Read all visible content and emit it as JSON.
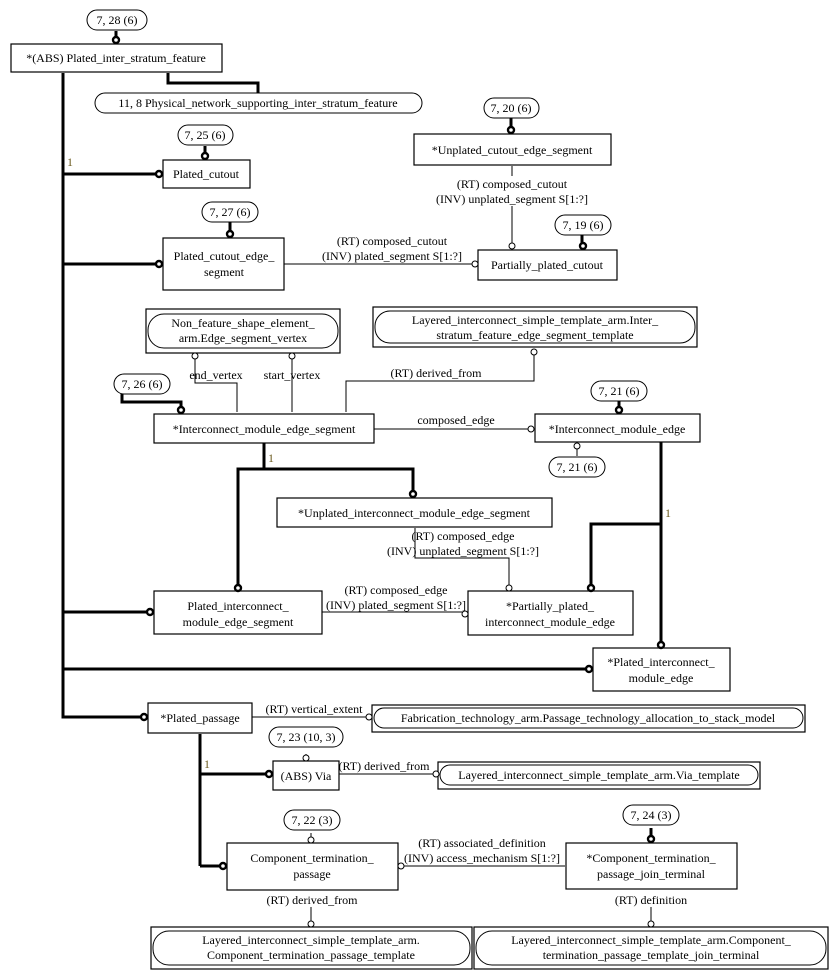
{
  "diagram": {
    "type": "EXPRESS-G schema diagram",
    "entities": {
      "plated_inter_stratum_feature": "*(ABS) Plated_inter_stratum_feature",
      "plated_cutout": "Plated_cutout",
      "unplated_cutout_edge_segment": "*Unplated_cutout_edge_segment",
      "plated_cutout_edge_segment": [
        "Plated_cutout_edge_",
        "segment"
      ],
      "partially_plated_cutout": "Partially_plated_cutout",
      "interconnect_module_edge_segment": "*Interconnect_module_edge_segment",
      "interconnect_module_edge": "*Interconnect_module_edge",
      "unplated_interconnect_module_edge_segment": "*Unplated_interconnect_module_edge_segment",
      "plated_interconnect_module_edge_segment": [
        "Plated_interconnect_",
        "module_edge_segment"
      ],
      "partially_plated_interconnect_module_edge": [
        "*Partially_plated_",
        "interconnect_module_edge"
      ],
      "plated_interconnect_module_edge": [
        "*Plated_interconnect_",
        "module_edge"
      ],
      "plated_passage": "*Plated_passage",
      "via": "(ABS) Via",
      "component_termination_passage": [
        "Component_termination_",
        "passage"
      ],
      "component_termination_passage_join_terminal": [
        "*Component_termination_",
        "passage_join_terminal"
      ]
    },
    "external_refs": {
      "physical_network": "11, 8 Physical_network_supporting_inter_stratum_feature",
      "edge_segment_vertex": [
        "Non_feature_shape_element_",
        "arm.Edge_segment_vertex"
      ],
      "inter_stratum_template": [
        "Layered_interconnect_simple_template_arm.Inter_",
        "stratum_feature_edge_segment_template"
      ],
      "passage_technology": "Fabrication_technology_arm.Passage_technology_allocation_to_stack_model",
      "via_template": "Layered_interconnect_simple_template_arm.Via_template",
      "ctp_template": [
        "Layered_interconnect_simple_template_arm.",
        "Component_termination_passage_template"
      ],
      "ctp_join_terminal_template": [
        "Layered_interconnect_simple_template_arm.Component_",
        "termination_passage_template_join_terminal"
      ]
    },
    "page_refs": {
      "r_7_28": "7, 28 (6)",
      "r_7_25": "7, 25 (6)",
      "r_7_20": "7, 20 (6)",
      "r_7_27": "7, 27 (6)",
      "r_7_19": "7, 19 (6)",
      "r_7_26": "7, 26 (6)",
      "r_7_21_top": "7, 21 (6)",
      "r_7_21_bottom": "7, 21 (6)",
      "r_7_23": "7, 23 (10, 3)",
      "r_7_22": "7, 22 (3)",
      "r_7_24": "7, 24 (3)"
    },
    "relationships": {
      "unplated_cutout": [
        "(RT) composed_cutout",
        "(INV) unplated_segment S[1:?]"
      ],
      "plated_cutout_seg": [
        "(RT) composed_cutout",
        "(INV) plated_segment S[1:?]"
      ],
      "end_vertex": "end_vertex",
      "start_vertex": "start_vertex",
      "derived_from_imes": "(RT) derived_from",
      "composed_edge": "composed_edge",
      "unplated_imes": [
        "(RT) composed_edge",
        "(INV) unplated_segment S[1:?]"
      ],
      "plated_imes": [
        "(RT) composed_edge",
        "(INV) plated_segment S[1:?]"
      ],
      "vertical_extent": "(RT) vertical_extent",
      "via_derived_from": "(RT) derived_from",
      "associated_definition": [
        "(RT) associated_definition",
        "(INV) access_mechanism S[1:?]"
      ],
      "ctp_derived_from": "(RT) derived_from",
      "definition": "(RT) definition"
    },
    "cardinality_labels": {
      "c1": "1",
      "c2": "1",
      "c3": "1",
      "c4": "1"
    },
    "colors": {
      "line": "#000000",
      "cardinality": "#6b5a1e",
      "background": "#ffffff"
    }
  }
}
